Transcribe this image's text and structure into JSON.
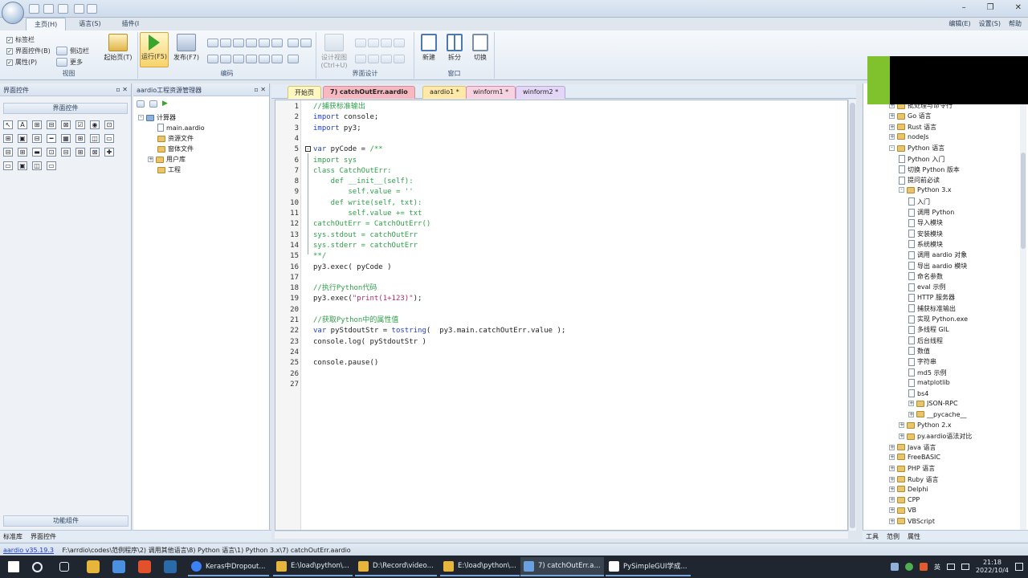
{
  "titlebar": {
    "window_controls": [
      "–",
      "❐",
      "✕"
    ]
  },
  "ribbon": {
    "tabs": [
      "主页(H)",
      "语言(S)",
      "插件(I"
    ],
    "right": [
      "编辑(E)",
      "设置(S)",
      "帮助"
    ],
    "view_checks": [
      "标签栏",
      "界面控件(B)",
      "属性(P)"
    ],
    "view_extra": [
      "侧边栏",
      "更多"
    ],
    "start_page": "起始页(T)",
    "run": "运行(F5)",
    "publish": "发布(F7)",
    "design_view": "设计视图",
    "design_hint": "(Ctrl+U)",
    "new": "新建",
    "split": "拆分",
    "switch": "切换",
    "group_labels": [
      "视图",
      "编码",
      "界面设计",
      "窗口"
    ]
  },
  "left_panel": {
    "title": "界面控件",
    "subtitle": "界面控件",
    "bottom_section": "功能组件",
    "tools": [
      "↖",
      "A",
      "⊞",
      "⊟",
      "⊠",
      "☑",
      "◉",
      "⊡",
      "⊞",
      "▣",
      "⊟",
      "━",
      "▦",
      "⊞",
      "◫",
      "▭",
      "⊟",
      "⊞",
      "▬",
      "⊡",
      "⊟",
      "⊞",
      "⊠",
      "✚",
      "▭",
      "▣",
      "◫",
      "▭"
    ]
  },
  "project_panel": {
    "title": "aardio工程资源管理器",
    "root": "计算器",
    "items": [
      "main.aardio",
      "资源文件",
      "窗体文件",
      "用户库",
      "工程"
    ]
  },
  "doc_tabs": [
    "开始页",
    "7) catchOutErr.aardio",
    "aardio1 *",
    "winform1 *",
    "winform2 *"
  ],
  "code": [
    {
      "n": "1",
      "parts": [
        {
          "c": "cm",
          "t": "//捕获标准输出"
        }
      ]
    },
    {
      "n": "2",
      "parts": [
        {
          "c": "kw",
          "t": "import"
        },
        {
          "c": "pl",
          "t": " console;"
        }
      ]
    },
    {
      "n": "3",
      "parts": [
        {
          "c": "kw",
          "t": "import"
        },
        {
          "c": "pl",
          "t": " py3;"
        }
      ]
    },
    {
      "n": "4",
      "parts": []
    },
    {
      "n": "5",
      "parts": [
        {
          "c": "kw",
          "t": "var"
        },
        {
          "c": "pl",
          "t": " pyCode = "
        },
        {
          "c": "cm",
          "t": "/**"
        }
      ]
    },
    {
      "n": "6",
      "parts": [
        {
          "c": "cm",
          "t": "import sys"
        }
      ]
    },
    {
      "n": "7",
      "parts": [
        {
          "c": "cm",
          "t": "class CatchOutErr:"
        }
      ]
    },
    {
      "n": "8",
      "parts": [
        {
          "c": "cm",
          "t": "    def __init__(self):"
        }
      ]
    },
    {
      "n": "9",
      "parts": [
        {
          "c": "cm",
          "t": "        self.value = ''"
        }
      ]
    },
    {
      "n": "10",
      "parts": [
        {
          "c": "cm",
          "t": "    def write(self, txt):"
        }
      ]
    },
    {
      "n": "11",
      "parts": [
        {
          "c": "cm",
          "t": "        self.value += txt"
        }
      ]
    },
    {
      "n": "12",
      "parts": [
        {
          "c": "cm",
          "t": "catchOutErr = CatchOutErr()"
        }
      ]
    },
    {
      "n": "13",
      "parts": [
        {
          "c": "cm",
          "t": "sys.stdout = catchOutErr"
        }
      ]
    },
    {
      "n": "14",
      "parts": [
        {
          "c": "cm",
          "t": "sys.stderr = catchOutErr"
        }
      ]
    },
    {
      "n": "15",
      "parts": [
        {
          "c": "cm",
          "t": "**/"
        }
      ]
    },
    {
      "n": "16",
      "parts": [
        {
          "c": "pl",
          "t": "py3.exec( pyCode )"
        }
      ]
    },
    {
      "n": "17",
      "parts": []
    },
    {
      "n": "18",
      "parts": [
        {
          "c": "cm",
          "t": "//执行Python代码"
        }
      ]
    },
    {
      "n": "19",
      "parts": [
        {
          "c": "pl",
          "t": "py3.exec("
        },
        {
          "c": "str",
          "t": "\"print(1+123)\""
        },
        {
          "c": "pl",
          "t": ");"
        }
      ]
    },
    {
      "n": "20",
      "parts": []
    },
    {
      "n": "21",
      "parts": [
        {
          "c": "cm",
          "t": "//获取Python中的属性值"
        }
      ]
    },
    {
      "n": "22",
      "parts": [
        {
          "c": "kw",
          "t": "var"
        },
        {
          "c": "pl",
          "t": " pyStdoutStr = "
        },
        {
          "c": "kw",
          "t": "tostring"
        },
        {
          "c": "pl",
          "t": "(  py3.main.catchOutErr.value );"
        }
      ]
    },
    {
      "n": "23",
      "parts": [
        {
          "c": "pl",
          "t": "console.log( pyStdoutStr )"
        }
      ]
    },
    {
      "n": "24",
      "parts": []
    },
    {
      "n": "25",
      "parts": [
        {
          "c": "pl",
          "t": "console.pause()"
        }
      ]
    },
    {
      "n": "26",
      "parts": []
    },
    {
      "n": "27",
      "parts": []
    }
  ],
  "right_tree": [
    {
      "lvl": 0,
      "exp": "+",
      "label": "批处理与命令行"
    },
    {
      "lvl": 0,
      "exp": "+",
      "label": "Go 语言"
    },
    {
      "lvl": 0,
      "exp": "+",
      "label": "Rust 语言"
    },
    {
      "lvl": 0,
      "exp": "+",
      "label": "nodeJs"
    },
    {
      "lvl": 0,
      "exp": "-",
      "label": "Python 语言"
    },
    {
      "lvl": 1,
      "exp": "",
      "label": "Python 入门"
    },
    {
      "lvl": 1,
      "exp": "",
      "label": "切换 Python 版本"
    },
    {
      "lvl": 1,
      "exp": "",
      "label": "提问前必读"
    },
    {
      "lvl": 1,
      "exp": "-",
      "label": "Python 3.x"
    },
    {
      "lvl": 2,
      "exp": "",
      "label": "入门"
    },
    {
      "lvl": 2,
      "exp": "",
      "label": "调用 Python"
    },
    {
      "lvl": 2,
      "exp": "",
      "label": "导入模块"
    },
    {
      "lvl": 2,
      "exp": "",
      "label": "安装模块"
    },
    {
      "lvl": 2,
      "exp": "",
      "label": "系统模块"
    },
    {
      "lvl": 2,
      "exp": "",
      "label": "调用 aardio 对象"
    },
    {
      "lvl": 2,
      "exp": "",
      "label": "导出 aardio 模块"
    },
    {
      "lvl": 2,
      "exp": "",
      "label": "命名参数"
    },
    {
      "lvl": 2,
      "exp": "",
      "label": "eval 示例"
    },
    {
      "lvl": 2,
      "exp": "",
      "label": "HTTP 服务器"
    },
    {
      "lvl": 2,
      "exp": "",
      "label": "捕获标准输出"
    },
    {
      "lvl": 2,
      "exp": "",
      "label": "实现 Python.exe"
    },
    {
      "lvl": 2,
      "exp": "",
      "label": "多线程 GIL"
    },
    {
      "lvl": 2,
      "exp": "",
      "label": "后台线程"
    },
    {
      "lvl": 2,
      "exp": "",
      "label": "数值"
    },
    {
      "lvl": 2,
      "exp": "",
      "label": "字符串"
    },
    {
      "lvl": 2,
      "exp": "",
      "label": "md5 示例"
    },
    {
      "lvl": 2,
      "exp": "",
      "label": "matplotlib"
    },
    {
      "lvl": 2,
      "exp": "",
      "label": "bs4"
    },
    {
      "lvl": 2,
      "exp": "+",
      "label": "JSON-RPC"
    },
    {
      "lvl": 2,
      "exp": "+",
      "label": "__pycache__"
    },
    {
      "lvl": 1,
      "exp": "+",
      "label": "Python 2.x"
    },
    {
      "lvl": 1,
      "exp": "+",
      "label": "py.aardio语法对比"
    },
    {
      "lvl": 0,
      "exp": "+",
      "label": "Java 语言"
    },
    {
      "lvl": 0,
      "exp": "+",
      "label": "FreeBASIC"
    },
    {
      "lvl": 0,
      "exp": "+",
      "label": "PHP 语言"
    },
    {
      "lvl": 0,
      "exp": "+",
      "label": "Ruby 语言"
    },
    {
      "lvl": 0,
      "exp": "+",
      "label": "Delphi"
    },
    {
      "lvl": 0,
      "exp": "+",
      "label": "CPP"
    },
    {
      "lvl": 0,
      "exp": "+",
      "label": "VB"
    },
    {
      "lvl": 0,
      "exp": "+",
      "label": "VBScript"
    }
  ],
  "bottom_tabs_left": [
    "标准库",
    "界面控件"
  ],
  "bottom_tabs_right": [
    "工具",
    "范例",
    "属性"
  ],
  "status": {
    "version": "aardio v35.19.3",
    "path": "F:\\arrdio\\codes\\范例程序\\2) 调用其他语言\\8) Python 语言\\1) Python 3.x\\7) catchOutErr.aardio"
  },
  "taskbar": {
    "apps": [
      "Keras中Dropout...",
      "E:\\load\\python\\...",
      "D:\\Record\\video...",
      "E:\\load\\python\\...",
      "7) catchOutErr.a...",
      "PySimpleGUI学成..."
    ],
    "ime": "英",
    "time": "21:18",
    "date": "2022/10/4"
  }
}
